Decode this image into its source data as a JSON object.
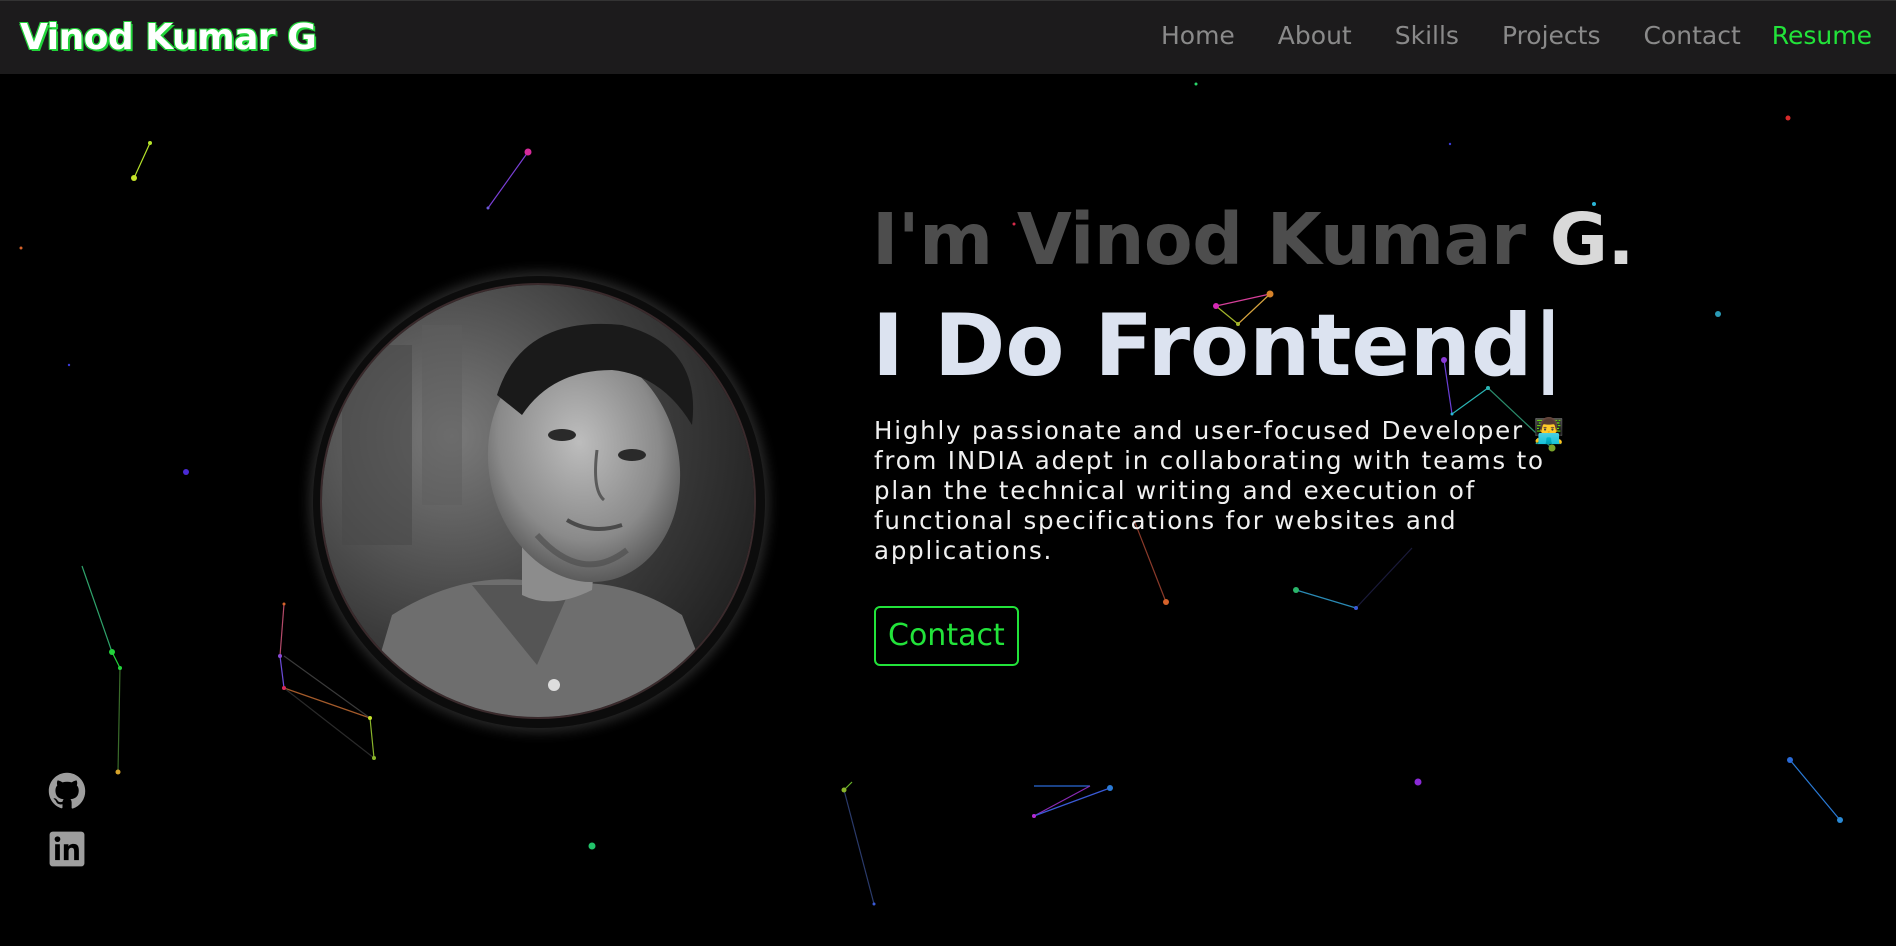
{
  "navbar": {
    "brand": "Vinod Kumar G",
    "links": [
      "Home",
      "About",
      "Skills",
      "Projects",
      "Contact"
    ],
    "resume": "Resume"
  },
  "hero": {
    "name_first": "I'm Vinod Kumar ",
    "name_last": "G.",
    "role": "I Do Frontend",
    "cursor": "|",
    "description": "Highly passionate and user-focused Developer 👨‍💻 from INDIA adept in collaborating with teams to plan the technical writing and execution of functional specifications for websites and applications.",
    "contact_button": "Contact"
  },
  "social": {
    "items": [
      "github-icon",
      "linkedin-icon"
    ]
  },
  "colors": {
    "background": "#000000",
    "navbar": "#1c1b1c",
    "accent": "#22e33a",
    "nav_text": "#8a8a8a"
  }
}
